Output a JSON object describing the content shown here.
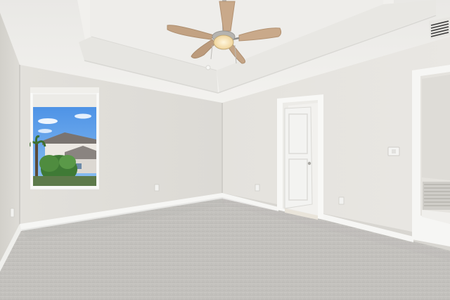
{
  "scene": {
    "kind": "photo",
    "subject": "empty-bedroom",
    "colors": {
      "wall": "#e3e1dc",
      "wall_shadow": "#d4d2cc",
      "ceiling": "#eeedea",
      "tray": "#f2f1ee",
      "carpet": "#c4c2be",
      "trim": "#f7f7f5",
      "door": "#f1f1ef",
      "fan_blade": "#c9a98a",
      "fan_metal": "#b8b6b2",
      "sky": "#5d9fe8",
      "tree": "#3f7a35"
    },
    "icons": [
      "ceiling-fan-icon",
      "light-switch-icon",
      "air-vent-icon",
      "outlet-icon"
    ]
  }
}
